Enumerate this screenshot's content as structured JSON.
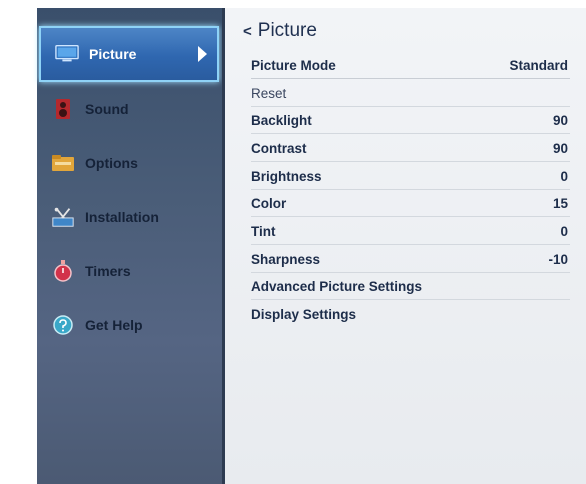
{
  "sidebar": {
    "items": [
      {
        "label": "Picture",
        "icon": "monitor-icon",
        "active": true
      },
      {
        "label": "Sound",
        "icon": "speaker-icon"
      },
      {
        "label": "Options",
        "icon": "folder-icon"
      },
      {
        "label": "Installation",
        "icon": "tools-icon"
      },
      {
        "label": "Timers",
        "icon": "timer-icon"
      },
      {
        "label": "Get Help",
        "icon": "help-icon"
      }
    ]
  },
  "panel": {
    "back_glyph": "<",
    "title": "Picture",
    "rows": [
      {
        "label": "Picture Mode",
        "value": "Standard"
      },
      {
        "label": "Reset",
        "value": ""
      },
      {
        "label": "Backlight",
        "value": "90"
      },
      {
        "label": "Contrast",
        "value": "90"
      },
      {
        "label": "Brightness",
        "value": "0"
      },
      {
        "label": "Color",
        "value": "15"
      },
      {
        "label": "Tint",
        "value": "0"
      },
      {
        "label": "Sharpness",
        "value": "-10"
      },
      {
        "label": "Advanced Picture Settings",
        "value": ""
      },
      {
        "label": "Display Settings",
        "value": ""
      }
    ]
  },
  "colors": {
    "active_item": "#2f67b0",
    "active_border": "#8fd3f7",
    "sidebar_bg": "#4a5d78",
    "panel_bg": "#eceff3"
  }
}
